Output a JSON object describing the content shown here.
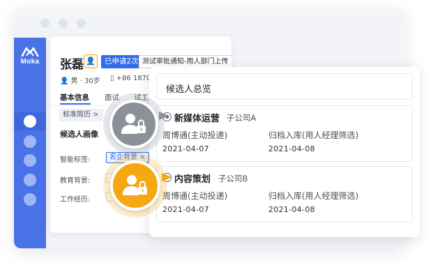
{
  "app": {
    "logo_text": "Moka"
  },
  "profile": {
    "name": "张磊",
    "applied_tag": "已申请2次",
    "notice_tag": "测试审批通知-用人部门上传",
    "gender_age": "男 · 30岁",
    "phone": "+86 1870",
    "tabs": [
      "基本信息",
      "面试",
      "试工"
    ],
    "standard_resume_chip": "标准简历 >",
    "portrait_title": "候选人画像",
    "smart_tag_label": "智能标签:",
    "smart_tag_value": "名企背景 ×",
    "education_label": "教育背景:",
    "work_label": "工作经历:"
  },
  "overview": {
    "title": "候选人总览",
    "cards": [
      {
        "position": "新媒体运营",
        "company": "子公司A",
        "source": "周博通(主动投递)",
        "source_date": "2021-04-07",
        "status": "归档入库(用人经理筛选)",
        "status_date": "2021-04-08"
      },
      {
        "position": "内容策划",
        "company": "子公司B",
        "source": "周博通(主动投递)",
        "source_date": "2021-04-07",
        "status": "归档入库(用人经理筛选)",
        "status_date": "2021-04-08"
      }
    ]
  },
  "colors": {
    "brand": "#4a72e8",
    "accent_blue": "#2f6bea",
    "gray_badge": "#8b9099",
    "gold_badge": "#f5a811"
  }
}
